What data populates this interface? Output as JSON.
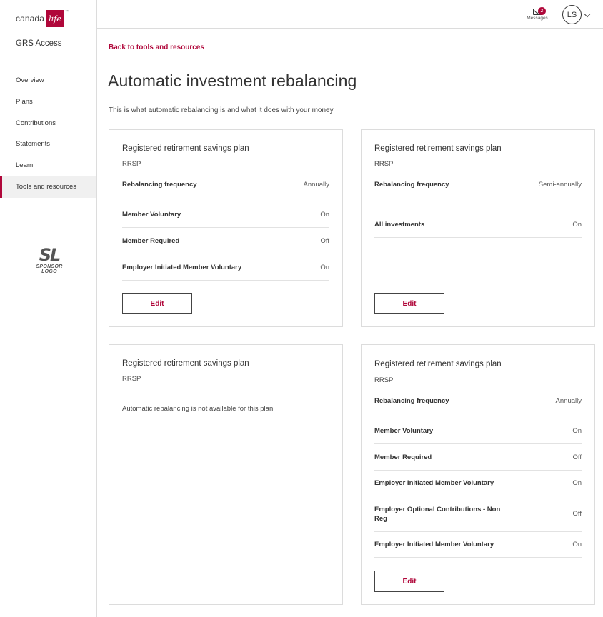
{
  "brand": {
    "name": "canada",
    "box": "life",
    "tm": "™",
    "color": "#b0073a"
  },
  "app_name": "GRS Access",
  "nav": {
    "items": [
      {
        "label": "Overview"
      },
      {
        "label": "Plans"
      },
      {
        "label": "Contributions"
      },
      {
        "label": "Statements"
      },
      {
        "label": "Learn"
      },
      {
        "label": "Tools and resources",
        "active": true
      }
    ]
  },
  "sponsor": {
    "mark": "SL",
    "text": "SPONSOR LOGO"
  },
  "header": {
    "messages_label": "Messages",
    "messages_count": "2",
    "avatar_initials": "LS"
  },
  "back_link": "Back to tools and resources",
  "page_title": "Automatic investment rebalancing",
  "subtitle": "This is what automatic rebalancing is and what it does with your money",
  "cards": [
    {
      "title": "Registered retirement savings plan",
      "sub": "RRSP",
      "freq_label": "Rebalancing frequency",
      "freq_value": "Annually",
      "rows": [
        {
          "label": "Member Voluntary",
          "value": "On"
        },
        {
          "label": "Member Required",
          "value": "Off"
        },
        {
          "label": "Employer Initiated Member Voluntary",
          "value": "On"
        }
      ],
      "edit": "Edit"
    },
    {
      "title": "Registered retirement savings plan",
      "sub": "RRSP",
      "freq_label": "Rebalancing frequency",
      "freq_value": "Semi-annually",
      "rows": [
        {
          "label": "All investments",
          "value": "On"
        }
      ],
      "edit": "Edit"
    },
    {
      "title": "Registered retirement savings plan",
      "sub": "RRSP",
      "note": "Automatic rebalancing is not available for this plan"
    },
    {
      "title": "Registered retirement savings plan",
      "sub": "RRSP",
      "freq_label": "Rebalancing frequency",
      "freq_value": "Annually",
      "rows": [
        {
          "label": "Member Voluntary",
          "value": "On"
        },
        {
          "label": "Member Required",
          "value": "Off"
        },
        {
          "label": "Employer Initiated Member Voluntary",
          "value": "On"
        },
        {
          "label": "Employer Optional Contributions - Non Reg",
          "value": "Off"
        },
        {
          "label": "Employer Initiated Member Voluntary",
          "value": "On"
        }
      ],
      "edit": "Edit"
    }
  ]
}
